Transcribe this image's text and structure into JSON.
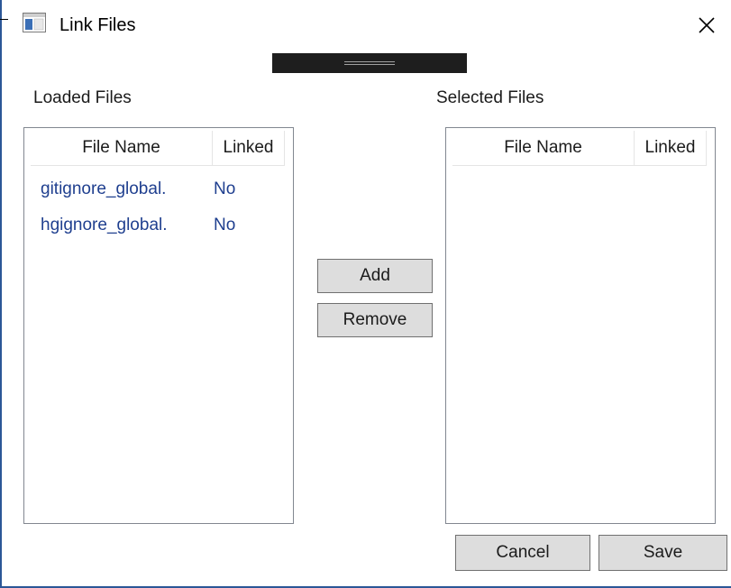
{
  "window": {
    "title": "Link Files",
    "close_glyph": "✕",
    "accent_color": "#2b5797"
  },
  "loaded": {
    "label": "Loaded Files",
    "columns": [
      "File Name",
      "Linked"
    ],
    "rows": [
      {
        "name": "gitignore_global.",
        "linked": "No"
      },
      {
        "name": "hgignore_global.",
        "linked": "No"
      }
    ]
  },
  "selected": {
    "label": "Selected Files",
    "columns": [
      "File Name",
      "Linked"
    ],
    "rows": []
  },
  "actions": {
    "add_label": "Add",
    "remove_label": "Remove"
  },
  "footer": {
    "cancel_label": "Cancel",
    "save_label": "Save"
  }
}
